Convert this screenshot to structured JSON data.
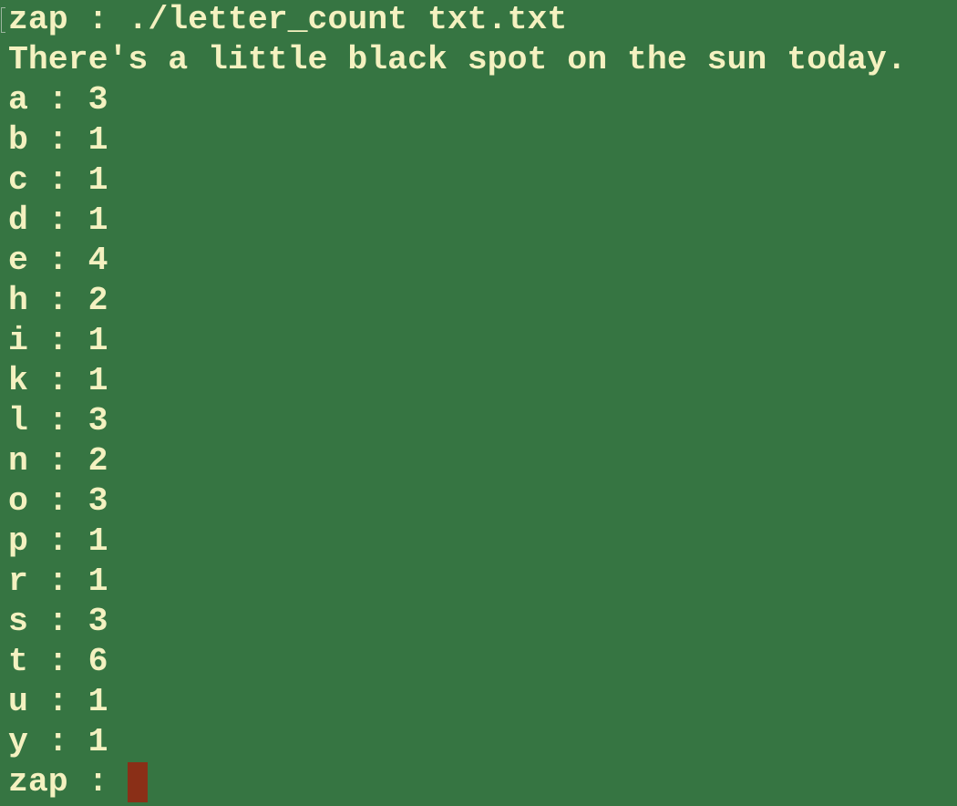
{
  "colors": {
    "background": "#367542",
    "text": "#f4f1c0",
    "cursor": "#8a2f17"
  },
  "terminal": {
    "command_prompt": "zap : ",
    "command": "./letter_count txt.txt",
    "file_content": "There's a little black spot on the sun today.",
    "counts": [
      {
        "letter": "a",
        "sep": " : ",
        "count": "3"
      },
      {
        "letter": "b",
        "sep": " : ",
        "count": "1"
      },
      {
        "letter": "c",
        "sep": " : ",
        "count": "1"
      },
      {
        "letter": "d",
        "sep": " : ",
        "count": "1"
      },
      {
        "letter": "e",
        "sep": " : ",
        "count": "4"
      },
      {
        "letter": "h",
        "sep": " : ",
        "count": "2"
      },
      {
        "letter": "i",
        "sep": " : ",
        "count": "1"
      },
      {
        "letter": "k",
        "sep": " : ",
        "count": "1"
      },
      {
        "letter": "l",
        "sep": " : ",
        "count": "3"
      },
      {
        "letter": "n",
        "sep": " : ",
        "count": "2"
      },
      {
        "letter": "o",
        "sep": " : ",
        "count": "3"
      },
      {
        "letter": "p",
        "sep": " : ",
        "count": "1"
      },
      {
        "letter": "r",
        "sep": " : ",
        "count": "1"
      },
      {
        "letter": "s",
        "sep": " : ",
        "count": "3"
      },
      {
        "letter": "t",
        "sep": " : ",
        "count": "6"
      },
      {
        "letter": "u",
        "sep": " : ",
        "count": "1"
      },
      {
        "letter": "y",
        "sep": " : ",
        "count": "1"
      }
    ],
    "final_prompt": "zap : "
  }
}
